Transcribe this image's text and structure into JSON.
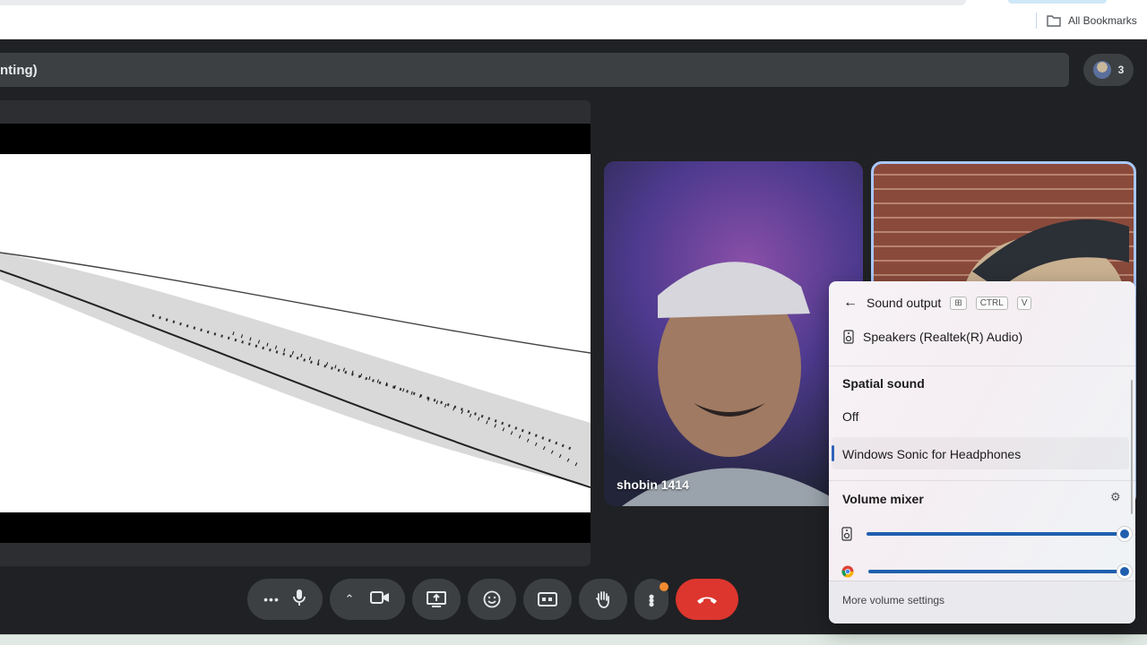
{
  "browser": {
    "bookmarks_label": "All Bookmarks"
  },
  "meeting": {
    "title_fragment": "nting)",
    "participant_count": "3"
  },
  "participants": [
    {
      "name": "shobin 1414"
    }
  ],
  "sound_flyout": {
    "title": "Sound output",
    "shortcut_keys": [
      "⊞",
      "CTRL",
      "V"
    ],
    "device": "Speakers (Realtek(R) Audio)",
    "spatial_sound_title": "Spatial sound",
    "spatial_options": [
      "Off",
      "Windows Sonic for Headphones"
    ],
    "spatial_selected": "Windows Sonic for Headphones",
    "volume_mixer_title": "Volume mixer",
    "mixer_levels": {
      "speakers": 100,
      "chrome": 100
    },
    "more_settings": "More volume settings",
    "accent_color": "#1f5fae"
  },
  "controls": {
    "end_call_color": "#dc362e"
  }
}
